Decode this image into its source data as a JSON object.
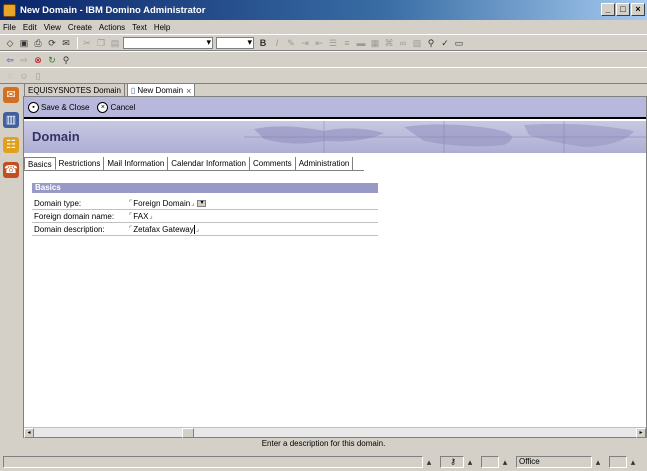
{
  "window": {
    "title": "New Domain - IBM Domino Administrator",
    "minimize": "_",
    "maximize": "□",
    "close": "×"
  },
  "menu": [
    "File",
    "Edit",
    "View",
    "Create",
    "Actions",
    "Text",
    "Help"
  ],
  "doc_tabs": [
    {
      "label": "EQUISYSNOTES Domain"
    },
    {
      "label": "New Domain"
    }
  ],
  "actions": {
    "save_close": "Save & Close",
    "cancel": "Cancel"
  },
  "banner": {
    "title": "Domain"
  },
  "form_tabs": [
    "Basics",
    "Restrictions",
    "Mail Information",
    "Calendar Information",
    "Comments",
    "Administration"
  ],
  "section": {
    "title": "Basics"
  },
  "fields": {
    "domain_type": {
      "label": "Domain type:",
      "value": "Foreign Domain"
    },
    "foreign_domain_name": {
      "label": "Foreign domain name:",
      "value": "FAX"
    },
    "domain_description": {
      "label": "Domain description:",
      "value": "Zetafax Gateway"
    }
  },
  "hint": "Enter a description for this domain.",
  "status": {
    "location": "Office"
  },
  "colors": {
    "titlebar": "#0a246a",
    "actionbar": "#b8b8dc",
    "section": "#9999c8"
  }
}
